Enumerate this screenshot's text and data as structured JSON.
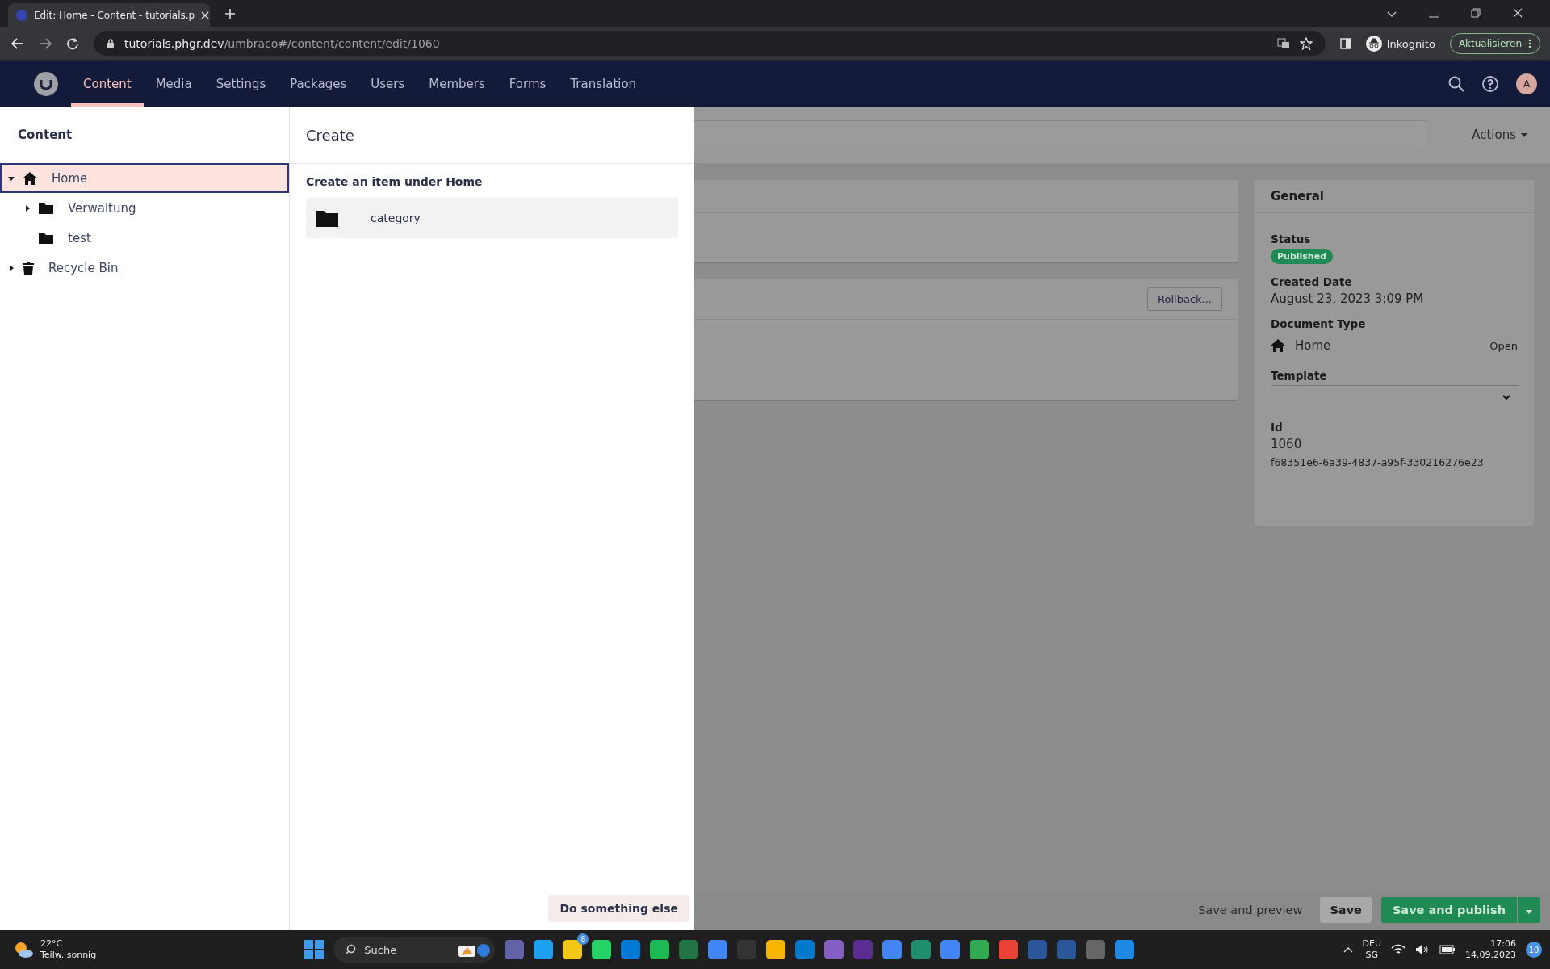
{
  "browser": {
    "tab_title": "Edit: Home - Content - tutorials.p",
    "url_host": "tutorials.phgr.dev",
    "url_path": "/umbraco#/content/content/edit/1060",
    "profile": "Inkognito",
    "update_button": "Aktualisieren"
  },
  "header": {
    "sections": [
      {
        "label": "Content",
        "selected": true
      },
      {
        "label": "Media",
        "selected": false
      },
      {
        "label": "Settings",
        "selected": false
      },
      {
        "label": "Packages",
        "selected": false
      },
      {
        "label": "Users",
        "selected": false
      },
      {
        "label": "Members",
        "selected": false
      },
      {
        "label": "Forms",
        "selected": false
      },
      {
        "label": "Translation",
        "selected": false
      }
    ],
    "avatar": "A"
  },
  "tree": {
    "title": "Content",
    "items": [
      {
        "label": "Home",
        "kind": "home",
        "selected": true,
        "expanded": true,
        "expandable": true,
        "children": [
          {
            "label": "Verwaltung",
            "kind": "folder",
            "selected": false,
            "expanded": false,
            "expandable": true
          },
          {
            "label": "test",
            "kind": "folder",
            "selected": false,
            "expandable": false
          }
        ]
      },
      {
        "label": "Recycle Bin",
        "kind": "trash",
        "selected": false,
        "expanded": false,
        "expandable": true
      }
    ]
  },
  "create": {
    "title": "Create",
    "subtitle": "Create an item under Home",
    "options": [
      {
        "label": "category"
      }
    ],
    "footer_button": "Do something else"
  },
  "editor": {
    "actions": "Actions",
    "rollback_button": "Rollback...",
    "general": {
      "title": "General",
      "status_label": "Status",
      "status": "Published",
      "created_label": "Created Date",
      "created": "August 23, 2023 3:09 PM",
      "doctype_label": "Document Type",
      "doctype": "Home",
      "open_link": "Open",
      "template_label": "Template",
      "id_label": "Id",
      "id": "1060",
      "guid": "f68351e6-6a39-4837-a95f-330216276e23"
    },
    "buttons": {
      "preview": "Save and preview",
      "save": "Save",
      "publish": "Save and publish"
    }
  },
  "taskbar": {
    "temperature": "22°C",
    "weather": "Teilw. sonnig",
    "search": "Suche",
    "badges": [
      "8",
      "10"
    ],
    "language": "DEU",
    "region": "SG",
    "time": "17:06",
    "date": "14.09.2023"
  }
}
